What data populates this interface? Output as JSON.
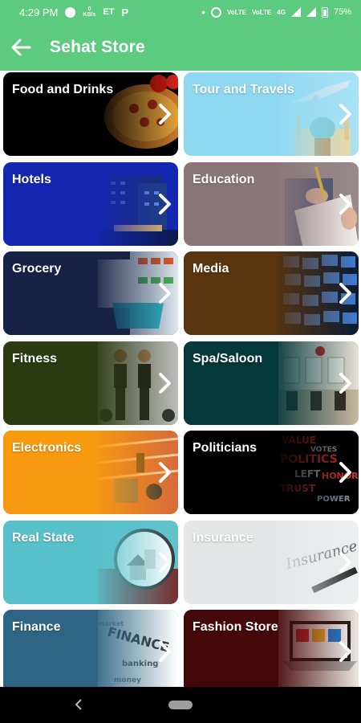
{
  "status_bar": {
    "time": "4:29 PM",
    "data_speed": "0\nKB/s",
    "carrier_text": "ET",
    "network_type": "4G",
    "battery": "75%"
  },
  "app_bar": {
    "title": "Sehat Store"
  },
  "categories": [
    {
      "label": "Food and Drinks",
      "color": "#000000",
      "art": "pizza"
    },
    {
      "label": "Tour and Travels",
      "color": "#8fd8f2",
      "art": "airplane-mosque"
    },
    {
      "label": "Hotels",
      "color": "#1527b0",
      "art": "hotel-building"
    },
    {
      "label": "Education",
      "color": "#8a7678",
      "art": "writing-hand"
    },
    {
      "label": "Grocery",
      "color": "#172346",
      "art": "shopping-cart"
    },
    {
      "label": "Media",
      "color": "#5a3510",
      "art": "screens-wall"
    },
    {
      "label": "Fitness",
      "color": "#2c3a12",
      "art": "gym-people"
    },
    {
      "label": "Spa/Saloon",
      "color": "#05383a",
      "art": "salon-interior"
    },
    {
      "label": "Electronics",
      "color": "#f79a0f",
      "art": "circuit-board"
    },
    {
      "label": "Politicians",
      "color": "#000000",
      "art": "word-cloud"
    },
    {
      "label": "Real State",
      "color": "#58c0cb",
      "art": "house-magnifier"
    },
    {
      "label": "Insurance",
      "color": "#e4e6e8",
      "art": "insurance-pen"
    },
    {
      "label": "Finance",
      "color": "#2f6584",
      "art": "finance-words"
    },
    {
      "label": "Fashion Store",
      "color": "#450808",
      "art": "laptop-shopping"
    }
  ]
}
